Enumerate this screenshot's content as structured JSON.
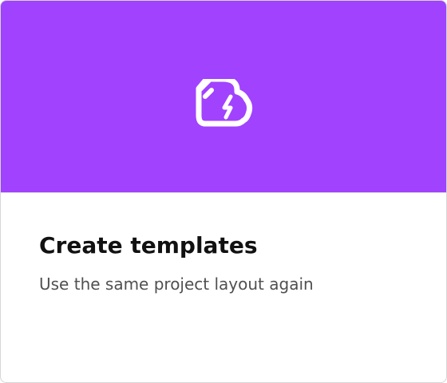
{
  "card": {
    "title": "Create templates",
    "subtitle": "Use the same project layout again",
    "icon": "template-lightning-icon",
    "banner_color": "#a142fe"
  }
}
